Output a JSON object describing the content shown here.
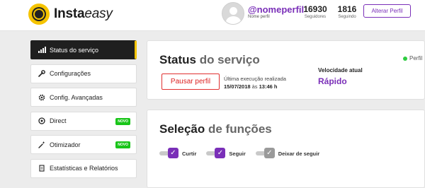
{
  "app": {
    "brand_bold": "Insta",
    "brand_light": "easy"
  },
  "header": {
    "profile_name": "@nomeperfil",
    "profile_sub": "Nome perfil",
    "followers_count": "16930",
    "followers_label": "Seguidores",
    "following_count": "1816",
    "following_label": "Seguindo",
    "alter_button": "Alterar Perfil"
  },
  "sidebar": {
    "items": [
      {
        "label": "Status do serviço",
        "icon": "bar-chart-icon",
        "active": true
      },
      {
        "label": "Configurações",
        "icon": "wrench-icon"
      },
      {
        "label": "Config. Avançadas",
        "icon": "gear-icon"
      },
      {
        "label": "Direct",
        "icon": "target-icon",
        "badge": "NOVO"
      },
      {
        "label": "Otimizador",
        "icon": "magic-wand-icon",
        "badge": "NOVO"
      },
      {
        "label": "Estatísticas e Relatórios",
        "icon": "document-icon"
      }
    ]
  },
  "status_panel": {
    "title_bold": "Status",
    "title_rest": " do serviço",
    "perfil_label": "Perfil",
    "pause_button": "Pausar perfil",
    "last_exec_label": "Última execução realizada",
    "last_exec_date": "15/07/2018",
    "last_exec_at": " às ",
    "last_exec_time": "13:46 h",
    "speed_label": "Velocidade atual",
    "speed_value": "Rápido"
  },
  "functions_panel": {
    "title_bold": "Seleção",
    "title_rest": " de funções",
    "toggles": [
      {
        "label": "Curtir",
        "enabled": true
      },
      {
        "label": "Seguir",
        "enabled": true
      },
      {
        "label": "Deixar de seguir",
        "enabled": false
      }
    ]
  },
  "colors": {
    "accent": "#7a2fb8",
    "brand_yellow": "#f5c400",
    "badge_green": "#19c519",
    "danger": "#e03030"
  }
}
